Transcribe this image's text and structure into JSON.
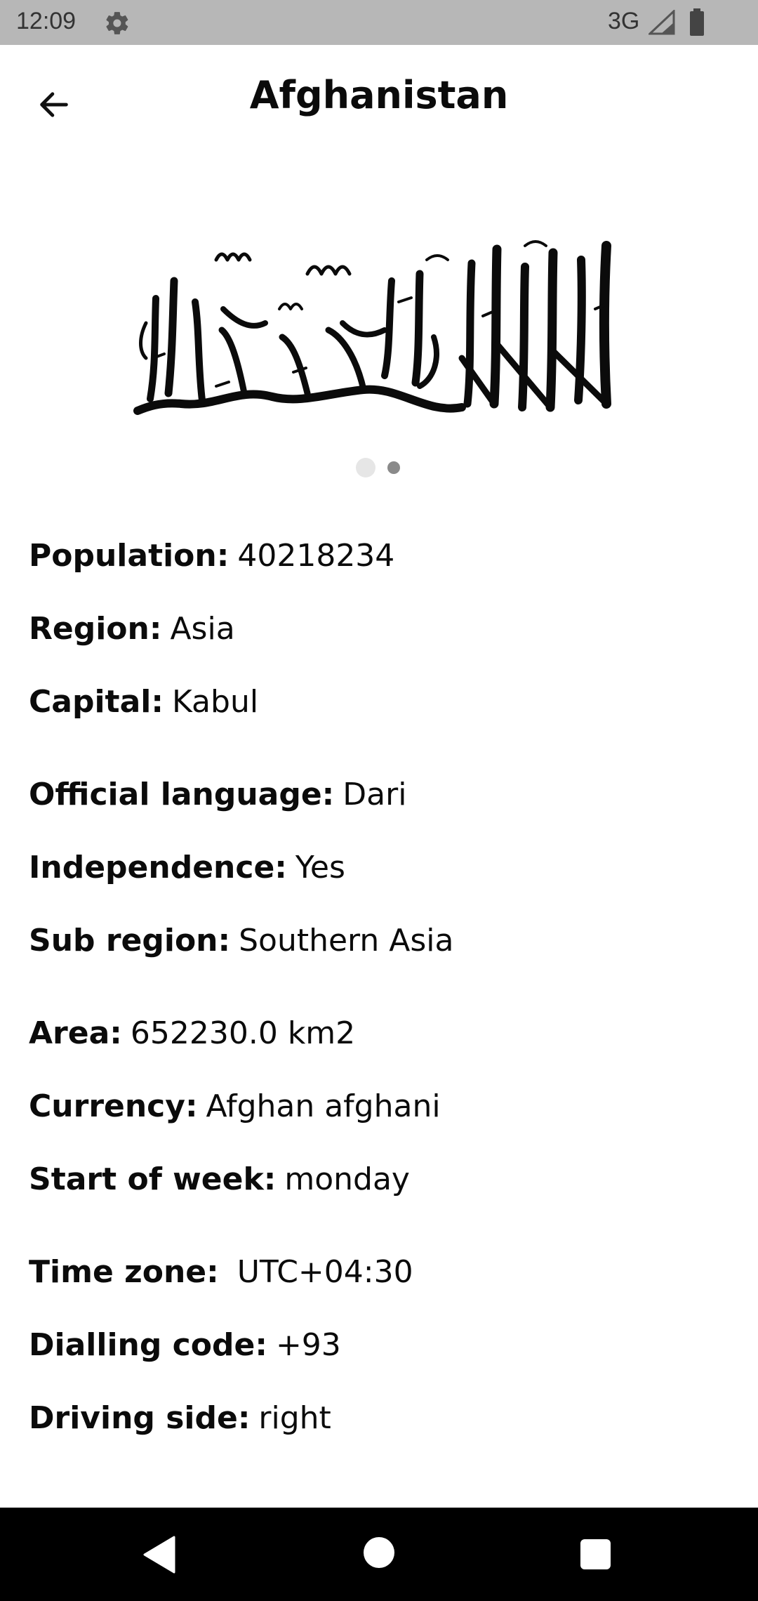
{
  "status_bar": {
    "time": "12:09",
    "network": "3G",
    "icons": [
      "gear-icon",
      "signal-icon",
      "battery-icon"
    ]
  },
  "app_bar": {
    "title": "Afghanistan",
    "back_icon": "arrow-left-icon"
  },
  "flag": {
    "pager_pages": 2,
    "active_page": 2
  },
  "details": [
    {
      "label": "Population:",
      "value": "40218234"
    },
    {
      "label": "Region:",
      "value": "Asia"
    },
    {
      "label": "Capital:",
      "value": "Kabul"
    },
    {
      "label": "Official language:",
      "value": "Dari"
    },
    {
      "label": "Independence:",
      "value": "Yes"
    },
    {
      "label": "Sub region:",
      "value": "Southern Asia"
    },
    {
      "label": "Area:",
      "value": "652230.0 km2"
    },
    {
      "label": "Currency:",
      "value": "Afghan afghani"
    },
    {
      "label": "Start of week:",
      "value": "monday"
    },
    {
      "label": "Time zone:",
      "value": " UTC+04:30"
    },
    {
      "label": "Dialling code:",
      "value": "+93"
    },
    {
      "label": "Driving side:",
      "value": "right"
    }
  ],
  "nav_bar": {
    "icons": [
      "back-triangle-icon",
      "home-circle-icon",
      "recents-square-icon"
    ]
  },
  "colors": {
    "status_bar_bg": "#b7b7b7",
    "nav_bar_bg": "#000000",
    "text": "#0b0b0b"
  }
}
